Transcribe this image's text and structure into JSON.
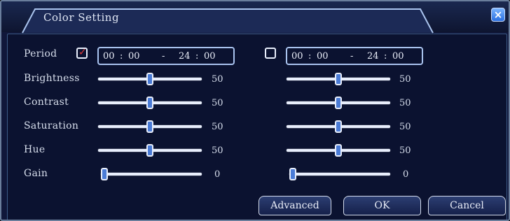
{
  "window": {
    "title": "Color Setting",
    "close_symbol": "×"
  },
  "period_label": "Period",
  "rows": [
    {
      "label": "Brightness",
      "values": [
        50,
        50
      ],
      "max": 100
    },
    {
      "label": "Contrast",
      "values": [
        50,
        50
      ],
      "max": 100
    },
    {
      "label": "Saturation",
      "values": [
        50,
        50
      ],
      "max": 100
    },
    {
      "label": "Hue",
      "values": [
        50,
        50
      ],
      "max": 100
    },
    {
      "label": "Gain",
      "values": [
        0,
        0
      ],
      "max": 100
    }
  ],
  "periods": [
    {
      "checked": true,
      "check_symbol": "✓",
      "start_h": "00",
      "start_m": "00",
      "end_h": "24",
      "end_m": "00"
    },
    {
      "checked": false,
      "check_symbol": "",
      "start_h": "00",
      "start_m": "00",
      "end_h": "24",
      "end_m": "00"
    }
  ],
  "time_sep": ":",
  "range_sep": "-",
  "buttons": {
    "advanced": "Advanced",
    "ok": "OK",
    "cancel": "Cancel"
  },
  "colors": {
    "check_mark": "#e23838",
    "accent": "#4a7bd6"
  }
}
